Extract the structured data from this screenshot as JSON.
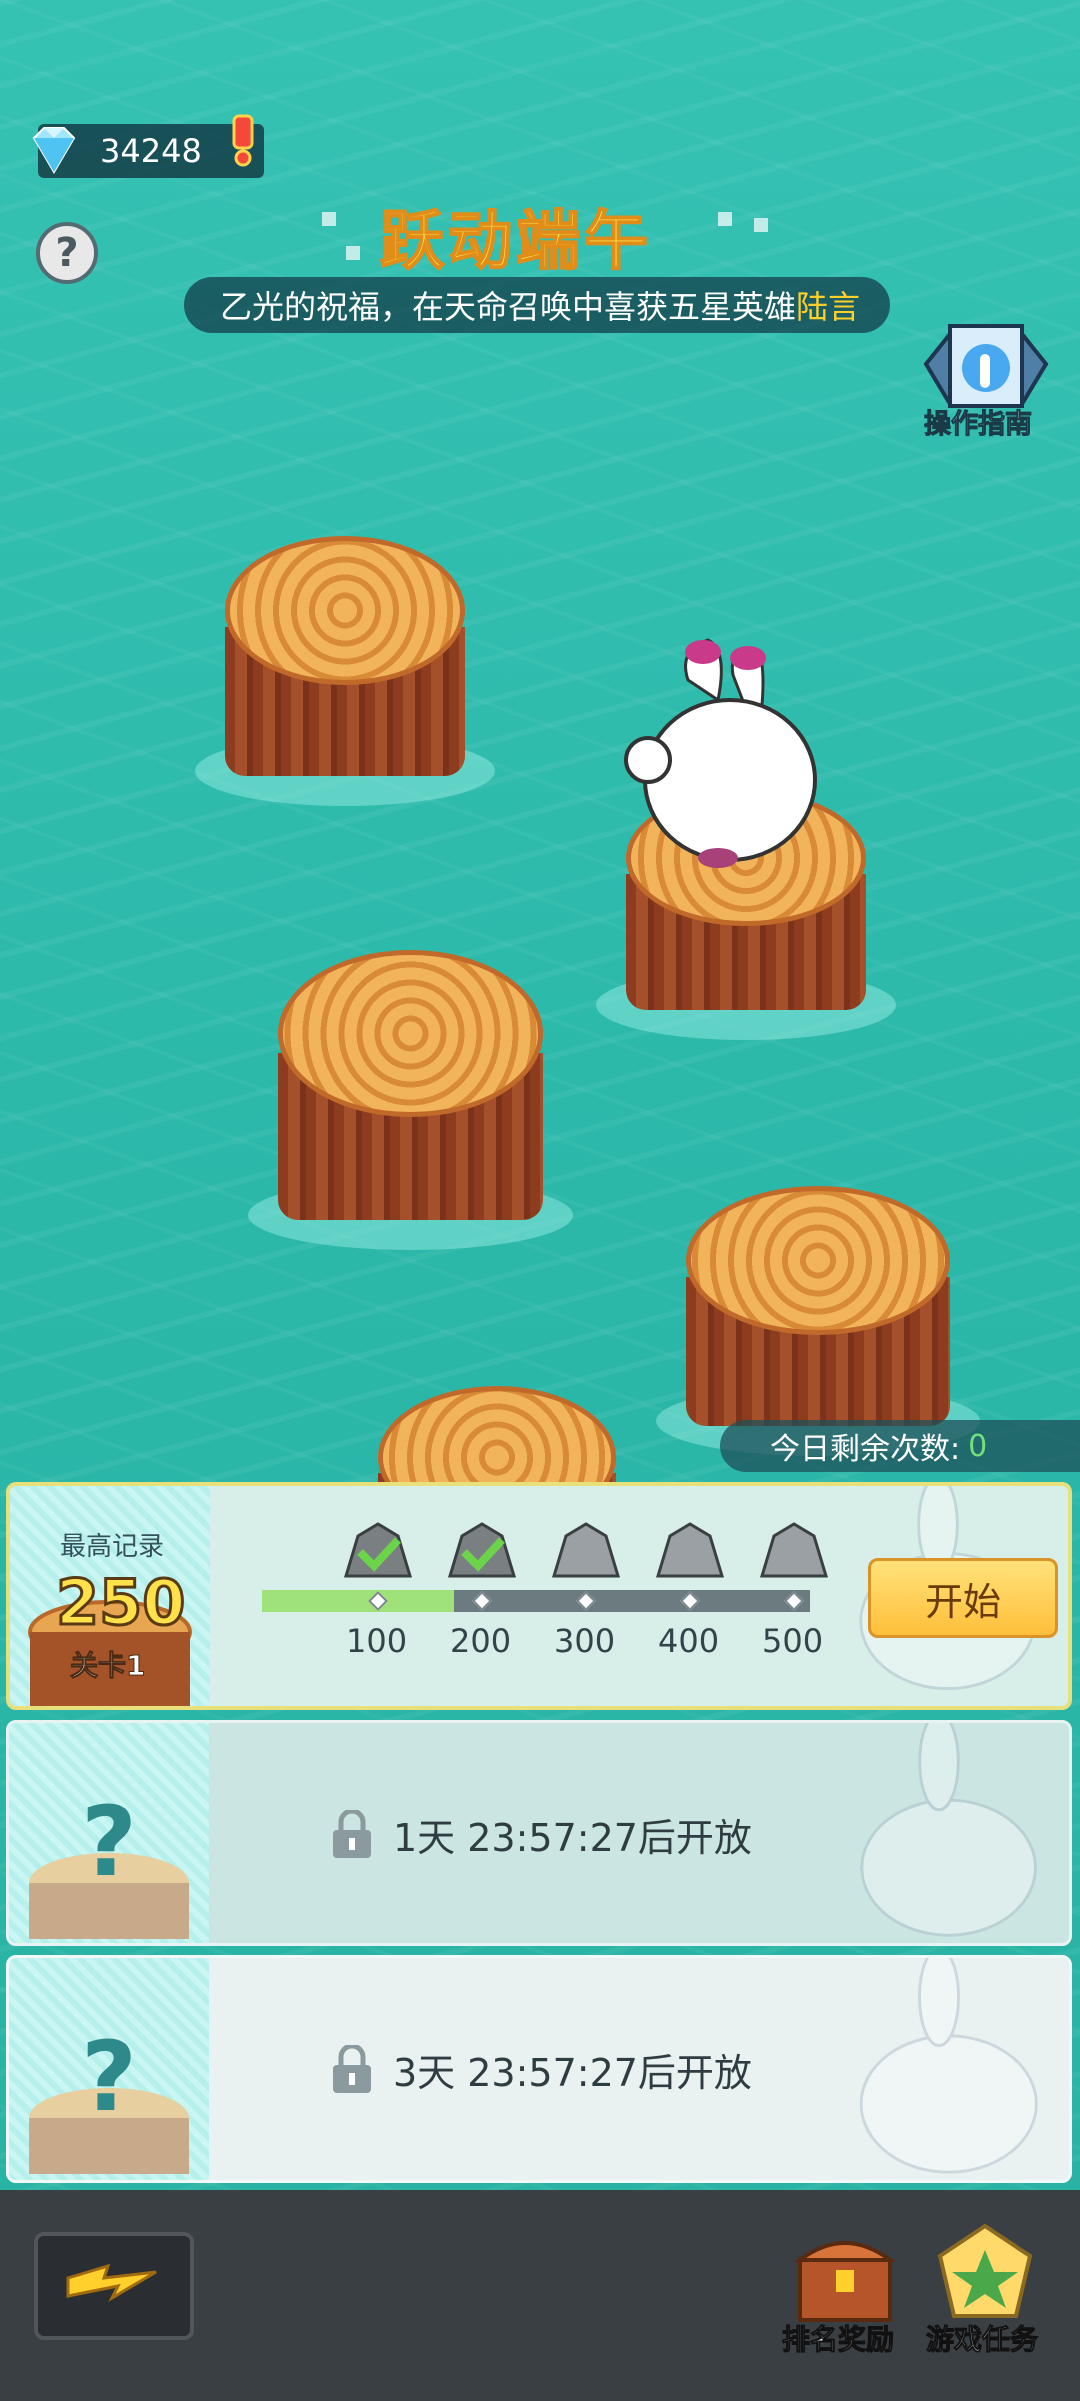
{
  "header": {
    "gems": "34248",
    "title": "跃动端午",
    "marquee_text": "乙光的祝福，在天命召唤中喜获五星英雄",
    "marquee_highlight": "陆言",
    "guide_label": "操作指南"
  },
  "icons": {
    "gem": "diamond-icon",
    "alert": "exclamation-icon",
    "help": "question-icon",
    "guide": "hand-pointer-icon",
    "lock": "lock-icon",
    "back": "lightning-arrow-icon",
    "ranking": "treasure-chest-icon",
    "tasks": "star-badge-icon"
  },
  "remaining": {
    "label": "今日剩余次数:",
    "value": "0"
  },
  "stage1": {
    "record_label": "最高记录",
    "record_value": "250",
    "stage_label": "关卡1",
    "milestones": [
      "100",
      "200",
      "300",
      "400",
      "500"
    ],
    "progress_fraction": 0.35,
    "achieved": [
      true,
      true,
      false,
      false,
      false
    ],
    "start_label": "开始"
  },
  "stage2": {
    "locked_text": "1天 23:57:27后开放"
  },
  "stage3": {
    "locked_text": "3天 23:57:27后开放"
  },
  "bottom": {
    "ranking_label": "排名奖励",
    "tasks_label": "游戏任务"
  },
  "colors": {
    "water": "#2bb8a9",
    "title": "#ffe04a",
    "highlight": "#ffd02c",
    "progress": "#9fe27a",
    "start_button": "#ffc84a"
  }
}
